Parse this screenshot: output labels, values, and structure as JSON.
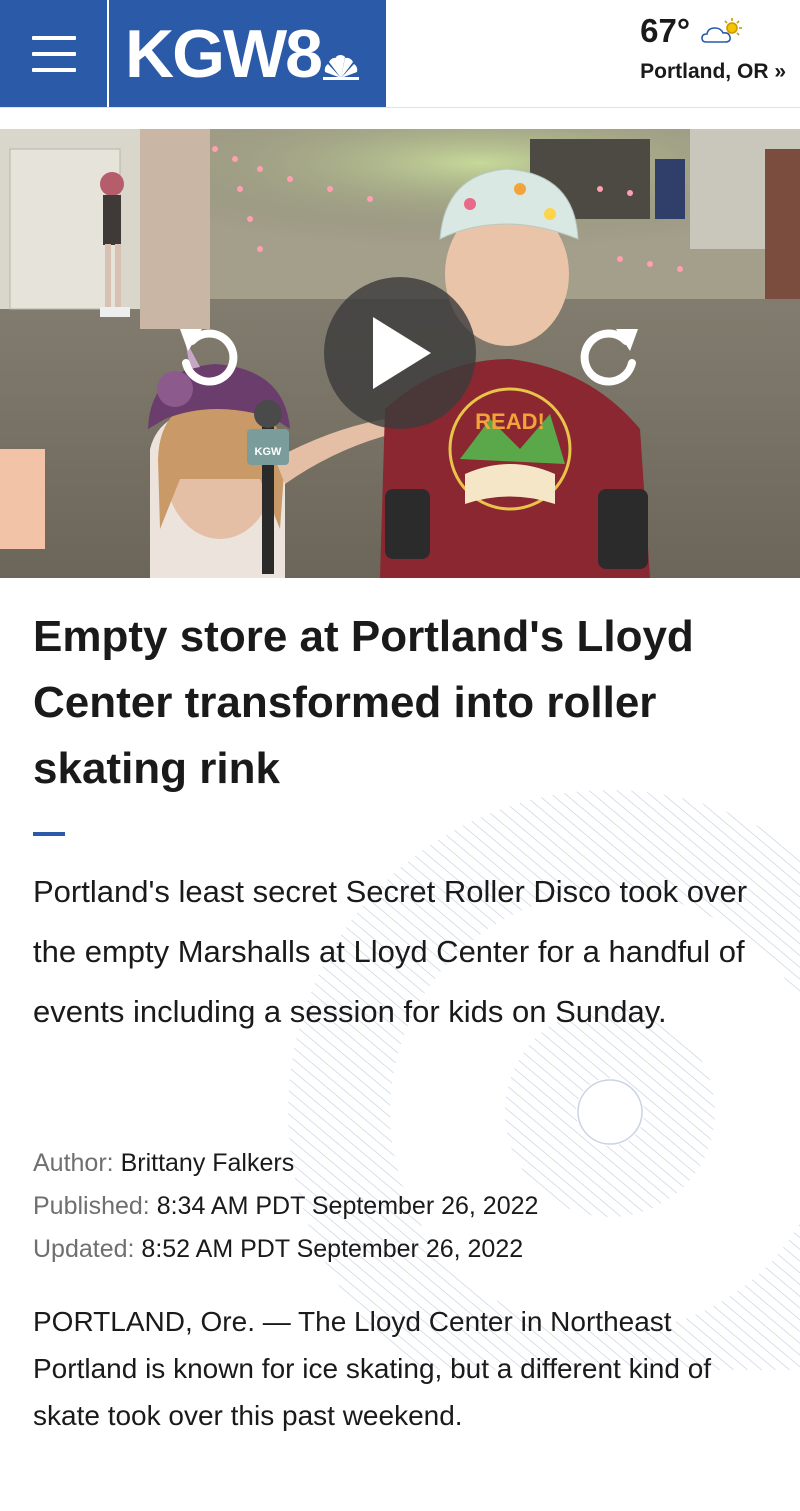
{
  "header": {
    "logo_text": "KGW8",
    "menu_icon": "hamburger-icon",
    "weather": {
      "temperature": "67°",
      "icon": "partly-sunny-icon",
      "location_link": "Portland, OR »"
    },
    "brand_color": "#2a5aa8"
  },
  "video": {
    "controls": {
      "rewind_icon": "rewind-icon",
      "play_icon": "play-icon",
      "forward_icon": "forward-icon"
    },
    "shirt_text": "READ!",
    "mic_flag_text": "KGW"
  },
  "article": {
    "headline": "Empty store at Portland's Lloyd Center transformed into roller skating rink",
    "summary": "Portland's least secret Secret Roller Disco took over the empty Marshalls at Lloyd Center for a handful of events including a session for kids on Sunday.",
    "author_label": "Author:",
    "author": "Brittany Falkers",
    "published_label": "Published:",
    "published": "8:34 AM PDT September 26, 2022",
    "updated_label": "Updated:",
    "updated": "8:52 AM PDT September 26, 2022",
    "body": "PORTLAND, Ore. — The Lloyd Center in Northeast Portland is known for ice skating, but a different kind of skate took over this past weekend."
  }
}
